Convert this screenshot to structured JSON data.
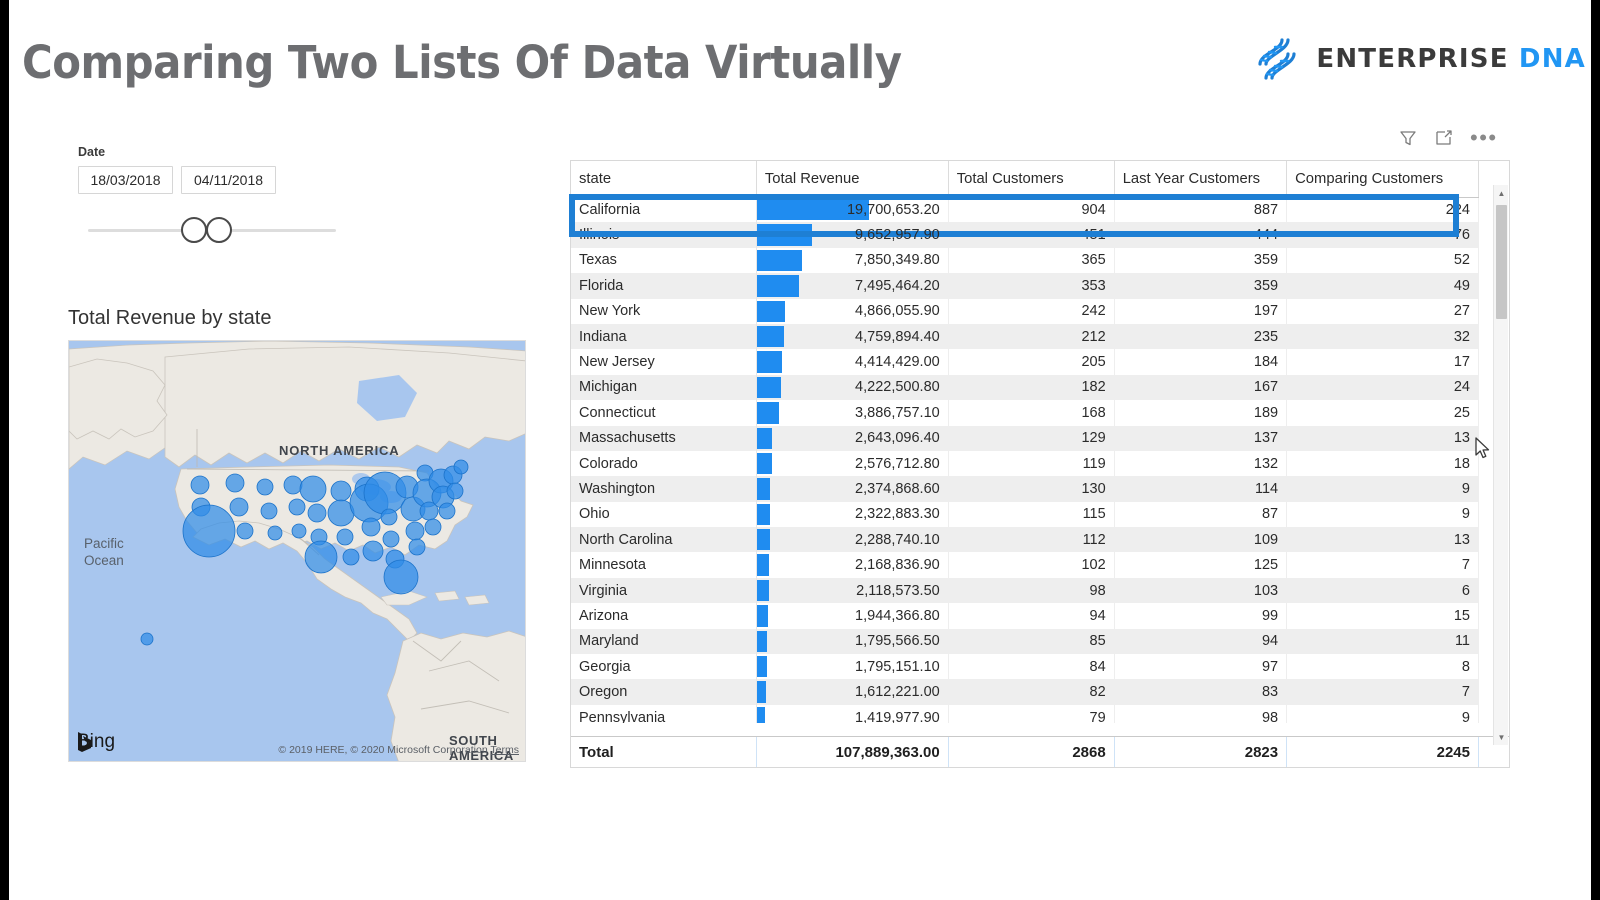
{
  "report": {
    "title": "Comparing Two Lists Of Data Virtually",
    "brand": {
      "primary": "ENTERPRISE",
      "secondary": "DNA",
      "icon": "dna-helix-icon",
      "accent": "#2196f3"
    }
  },
  "slicer": {
    "label": "Date",
    "start_date": "18/03/2018",
    "end_date": "04/11/2018"
  },
  "map": {
    "title": "Total Revenue by state",
    "provider_logo": "Bing",
    "continent_label": "NORTH AMERICA",
    "continent_label_2": "SOUTH AMERICA",
    "ocean_label": "Pacific\nOcean",
    "attribution": "© 2019 HERE, © 2020 Microsoft Corporation",
    "terms": "Terms"
  },
  "visual_header": {
    "filter_icon": "filter-funnel-icon",
    "focus_icon": "focus-mode-icon",
    "more_label": "•••"
  },
  "table": {
    "columns": [
      "state",
      "Total Revenue",
      "Total Customers",
      "Last Year Customers",
      "Comparing Customers"
    ],
    "highlighted_row": "California",
    "max_revenue": 19700653.2,
    "rows": [
      {
        "state": "California",
        "revenue": "19,700,653.20",
        "revenue_num": 19700653.2,
        "total_customers": "904",
        "last_year_customers": "887",
        "comparing_customers": "224"
      },
      {
        "state": "Illinois",
        "revenue": "9,652,957.90",
        "revenue_num": 9652957.9,
        "total_customers": "451",
        "last_year_customers": "444",
        "comparing_customers": "76"
      },
      {
        "state": "Texas",
        "revenue": "7,850,349.80",
        "revenue_num": 7850349.8,
        "total_customers": "365",
        "last_year_customers": "359",
        "comparing_customers": "52"
      },
      {
        "state": "Florida",
        "revenue": "7,495,464.20",
        "revenue_num": 7495464.2,
        "total_customers": "353",
        "last_year_customers": "359",
        "comparing_customers": "49"
      },
      {
        "state": "New York",
        "revenue": "4,866,055.90",
        "revenue_num": 4866055.9,
        "total_customers": "242",
        "last_year_customers": "197",
        "comparing_customers": "27"
      },
      {
        "state": "Indiana",
        "revenue": "4,759,894.40",
        "revenue_num": 4759894.4,
        "total_customers": "212",
        "last_year_customers": "235",
        "comparing_customers": "32"
      },
      {
        "state": "New Jersey",
        "revenue": "4,414,429.00",
        "revenue_num": 4414429.0,
        "total_customers": "205",
        "last_year_customers": "184",
        "comparing_customers": "17"
      },
      {
        "state": "Michigan",
        "revenue": "4,222,500.80",
        "revenue_num": 4222500.8,
        "total_customers": "182",
        "last_year_customers": "167",
        "comparing_customers": "24"
      },
      {
        "state": "Connecticut",
        "revenue": "3,886,757.10",
        "revenue_num": 3886757.1,
        "total_customers": "168",
        "last_year_customers": "189",
        "comparing_customers": "25"
      },
      {
        "state": "Massachusetts",
        "revenue": "2,643,096.40",
        "revenue_num": 2643096.4,
        "total_customers": "129",
        "last_year_customers": "137",
        "comparing_customers": "13"
      },
      {
        "state": "Colorado",
        "revenue": "2,576,712.80",
        "revenue_num": 2576712.8,
        "total_customers": "119",
        "last_year_customers": "132",
        "comparing_customers": "18"
      },
      {
        "state": "Washington",
        "revenue": "2,374,868.60",
        "revenue_num": 2374868.6,
        "total_customers": "130",
        "last_year_customers": "114",
        "comparing_customers": "9"
      },
      {
        "state": "Ohio",
        "revenue": "2,322,883.30",
        "revenue_num": 2322883.3,
        "total_customers": "115",
        "last_year_customers": "87",
        "comparing_customers": "9"
      },
      {
        "state": "North Carolina",
        "revenue": "2,288,740.10",
        "revenue_num": 2288740.1,
        "total_customers": "112",
        "last_year_customers": "109",
        "comparing_customers": "13"
      },
      {
        "state": "Minnesota",
        "revenue": "2,168,836.90",
        "revenue_num": 2168836.9,
        "total_customers": "102",
        "last_year_customers": "125",
        "comparing_customers": "7"
      },
      {
        "state": "Virginia",
        "revenue": "2,118,573.50",
        "revenue_num": 2118573.5,
        "total_customers": "98",
        "last_year_customers": "103",
        "comparing_customers": "6"
      },
      {
        "state": "Arizona",
        "revenue": "1,944,366.80",
        "revenue_num": 1944366.8,
        "total_customers": "94",
        "last_year_customers": "99",
        "comparing_customers": "15"
      },
      {
        "state": "Maryland",
        "revenue": "1,795,566.50",
        "revenue_num": 1795566.5,
        "total_customers": "85",
        "last_year_customers": "94",
        "comparing_customers": "11"
      },
      {
        "state": "Georgia",
        "revenue": "1,795,151.10",
        "revenue_num": 1795151.1,
        "total_customers": "84",
        "last_year_customers": "97",
        "comparing_customers": "8"
      },
      {
        "state": "Oregon",
        "revenue": "1,612,221.00",
        "revenue_num": 1612221.0,
        "total_customers": "82",
        "last_year_customers": "83",
        "comparing_customers": "7"
      },
      {
        "state": "Pennsylvania",
        "revenue": "1,419,977.90",
        "revenue_num": 1419977.9,
        "total_customers": "79",
        "last_year_customers": "98",
        "comparing_customers": "9"
      }
    ],
    "total": {
      "label": "Total",
      "revenue": "107,889,363.00",
      "total_customers": "2868",
      "last_year_customers": "2823",
      "comparing_customers": "2245"
    }
  }
}
